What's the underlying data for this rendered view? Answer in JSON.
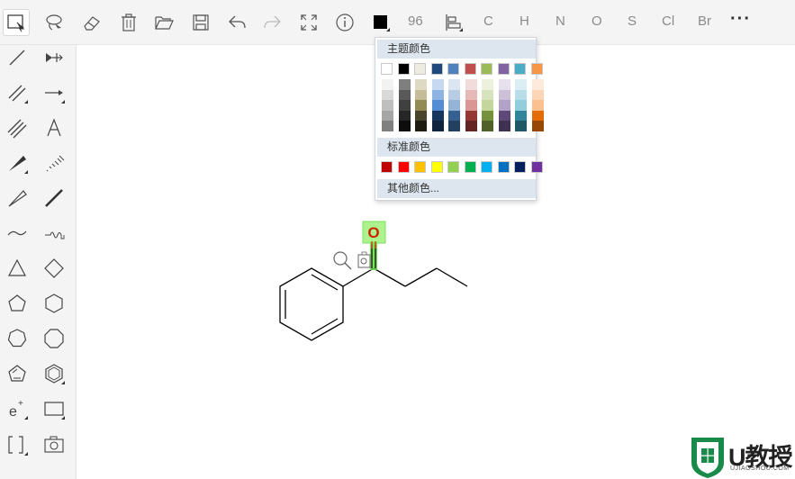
{
  "toolbar": {
    "font_size": "96",
    "elements": [
      "C",
      "H",
      "N",
      "O",
      "S",
      "Cl",
      "Br"
    ],
    "more": "···",
    "current_color": "#000000"
  },
  "color_picker": {
    "theme_header": "主题颜色",
    "standard_header": "标准颜色",
    "more_colors": "其他颜色...",
    "theme_colors": [
      "#ffffff",
      "#000000",
      "#eeece1",
      "#1f497d",
      "#4f81bd",
      "#c0504d",
      "#9bbb59",
      "#8064a2",
      "#4bacc6",
      "#f79646"
    ],
    "theme_shades": [
      [
        "#f2f2f2",
        "#d9d9d9",
        "#bfbfbf",
        "#a6a6a6",
        "#808080"
      ],
      [
        "#7f7f7f",
        "#595959",
        "#404040",
        "#262626",
        "#0d0d0d"
      ],
      [
        "#ddd9c3",
        "#c4bd97",
        "#938953",
        "#4a452a",
        "#1e1c11"
      ],
      [
        "#c6d9f0",
        "#8db3e2",
        "#548dd4",
        "#17365d",
        "#0f243e"
      ],
      [
        "#dbe5f1",
        "#b8cce4",
        "#95b3d7",
        "#366092",
        "#244061"
      ],
      [
        "#f2dcdb",
        "#e6b9b8",
        "#d99694",
        "#953734",
        "#632423"
      ],
      [
        "#ebf1dd",
        "#d7e3bc",
        "#c3d69b",
        "#76923c",
        "#4f6128"
      ],
      [
        "#e5e0ec",
        "#ccc1d9",
        "#b2a2c7",
        "#5f497a",
        "#3f3151"
      ],
      [
        "#dbeef3",
        "#b7dde8",
        "#92cddc",
        "#31859b",
        "#205867"
      ],
      [
        "#fdeada",
        "#fbd5b5",
        "#fac08f",
        "#e36c09",
        "#974806"
      ]
    ],
    "standard_colors": [
      "#c00000",
      "#ff0000",
      "#ffc000",
      "#ffff00",
      "#92d050",
      "#00b050",
      "#00b0f0",
      "#0070c0",
      "#002060",
      "#7030a0"
    ]
  },
  "molecule": {
    "selected_atom": "O",
    "selected_atom_color": "#cc2200",
    "selection_color": "#66dd44"
  },
  "watermark": {
    "brand": "U教授",
    "url": "UJIAOSHOU.COM",
    "color": "#1a8a4a"
  }
}
